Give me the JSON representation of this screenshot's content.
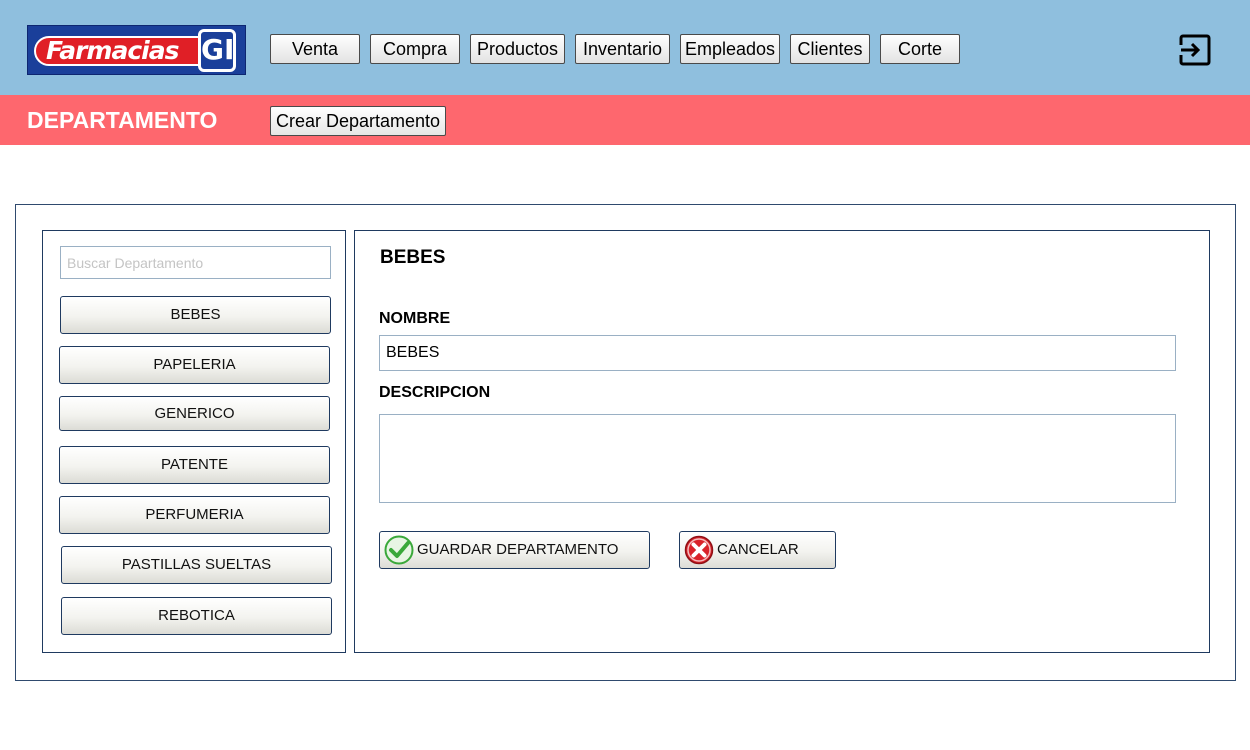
{
  "app": {
    "logo_text": "Farmacias",
    "logo_badge": "GI"
  },
  "nav": {
    "items": [
      {
        "label": "Venta"
      },
      {
        "label": "Compra"
      },
      {
        "label": "Productos"
      },
      {
        "label": "Inventario"
      },
      {
        "label": "Empleados"
      },
      {
        "label": "Clientes"
      },
      {
        "label": "Corte"
      }
    ],
    "logout_icon": "logout-icon"
  },
  "section": {
    "title": "DEPARTAMENTO",
    "create_label": "Crear Departamento"
  },
  "sidebar": {
    "search_placeholder": "Buscar Departamento",
    "search_value": "",
    "departments": [
      {
        "label": "BEBES"
      },
      {
        "label": "PAPELERIA"
      },
      {
        "label": "GENERICO"
      },
      {
        "label": "PATENTE"
      },
      {
        "label": "PERFUMERIA"
      },
      {
        "label": "PASTILLAS SUELTAS"
      },
      {
        "label": "REBOTICA"
      }
    ]
  },
  "detail": {
    "title": "BEBES",
    "name_label": "NOMBRE",
    "name_value": "BEBES",
    "description_label": "DESCRIPCION",
    "description_value": "",
    "save_label": "GUARDAR DEPARTAMENTO",
    "cancel_label": "CANCELAR"
  },
  "colors": {
    "topbar": "#8fbfde",
    "section_bar": "#fe676e",
    "panel_border": "#1f3a60",
    "save_icon": "#3aa83a",
    "cancel_icon": "#d9232a"
  }
}
